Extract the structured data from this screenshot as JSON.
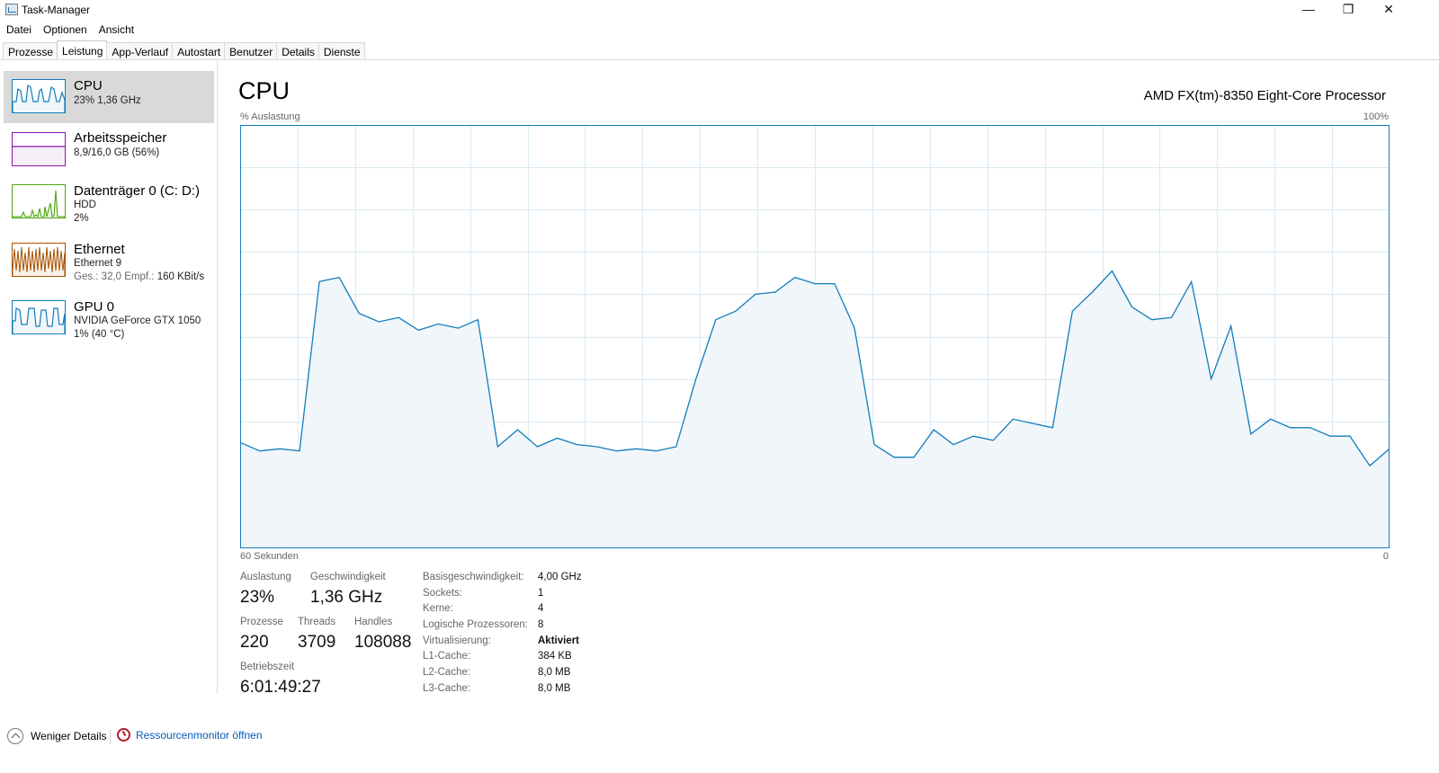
{
  "window": {
    "title": "Task-Manager",
    "controls": {
      "minimize": "—",
      "maximize": "❐",
      "close": "✕"
    }
  },
  "menu": [
    "Datei",
    "Optionen",
    "Ansicht"
  ],
  "tabs": [
    "Prozesse",
    "Leistung",
    "App-Verlauf",
    "Autostart",
    "Benutzer",
    "Details",
    "Dienste"
  ],
  "active_tab": "Leistung",
  "sidebar": {
    "items": [
      {
        "title": "CPU",
        "line1": "23%  1,36 GHz",
        "line2": "",
        "color": "#117dbb",
        "selected": true
      },
      {
        "title": "Arbeitsspeicher",
        "line1": "8,9/16,0 GB (56%)",
        "line2": "",
        "color": "#8b12ae",
        "selected": false
      },
      {
        "title": "Datenträger 0 (C: D:)",
        "line1": "HDD",
        "line2": "2%",
        "color": "#4da60c",
        "selected": false
      },
      {
        "title": "Ethernet",
        "line1": "Ethernet 9",
        "line2_label": "Ges.: 32,0  Empf.:",
        "line2_value": "160 KBit/s",
        "color": "#a74f01",
        "selected": false
      },
      {
        "title": "GPU 0",
        "line1": "NVIDIA GeForce GTX 1050",
        "line2": "1% (40 °C)",
        "color": "#117dbb",
        "selected": false
      }
    ]
  },
  "main": {
    "heading": "CPU",
    "processor": "AMD FX(tm)-8350 Eight-Core Processor",
    "axis": {
      "top_left": "% Auslastung",
      "top_right": "100%",
      "bottom_left": "60 Sekunden",
      "bottom_right": "0"
    },
    "stats": {
      "auslastung_label": "Auslastung",
      "auslastung_value": "23%",
      "geschwindigkeit_label": "Geschwindigkeit",
      "geschwindigkeit_value": "1,36 GHz",
      "prozesse_label": "Prozesse",
      "prozesse_value": "220",
      "threads_label": "Threads",
      "threads_value": "3709",
      "handles_label": "Handles",
      "handles_value": "108088",
      "betriebszeit_label": "Betriebszeit",
      "betriebszeit_value": "6:01:49:27"
    },
    "info": [
      {
        "label": "Basisgeschwindigkeit:",
        "value": "4,00 GHz"
      },
      {
        "label": "Sockets:",
        "value": "1"
      },
      {
        "label": "Kerne:",
        "value": "4"
      },
      {
        "label": "Logische Prozessoren:",
        "value": "8"
      },
      {
        "label": "Virtualisierung:",
        "value": "Aktiviert"
      },
      {
        "label": "L1-Cache:",
        "value": "384 KB"
      },
      {
        "label": "L2-Cache:",
        "value": "8,0 MB"
      },
      {
        "label": "L3-Cache:",
        "value": "8,0 MB"
      }
    ]
  },
  "footer": {
    "less_details": "Weniger Details",
    "resource_monitor": "Ressourcenmonitor öffnen"
  },
  "chart_data": {
    "type": "area",
    "title": "CPU",
    "xlabel": "60 Sekunden",
    "ylabel": "% Auslastung",
    "ylim": [
      0,
      100
    ],
    "x_range_seconds": [
      60,
      0
    ],
    "grid": true,
    "color": "#117dbb",
    "fill": "#f1f6fa",
    "values": [
      25,
      23,
      23.5,
      23,
      63,
      64,
      55.5,
      53.5,
      54.5,
      51.5,
      53,
      52,
      54,
      24,
      28,
      24,
      26,
      24.5,
      24,
      23,
      23.5,
      23,
      24,
      40,
      54,
      56,
      60,
      60.5,
      64,
      62.5,
      62.5,
      52,
      24.5,
      21.5,
      21.5,
      28,
      24.5,
      26.5,
      25.5,
      30.5,
      29.5,
      28.5,
      56,
      60.5,
      65.5,
      57,
      54,
      54.5,
      63,
      40,
      52.5,
      27,
      30.5,
      28.5,
      28.5,
      26.5,
      26.5,
      19.5,
      23.5
    ]
  }
}
